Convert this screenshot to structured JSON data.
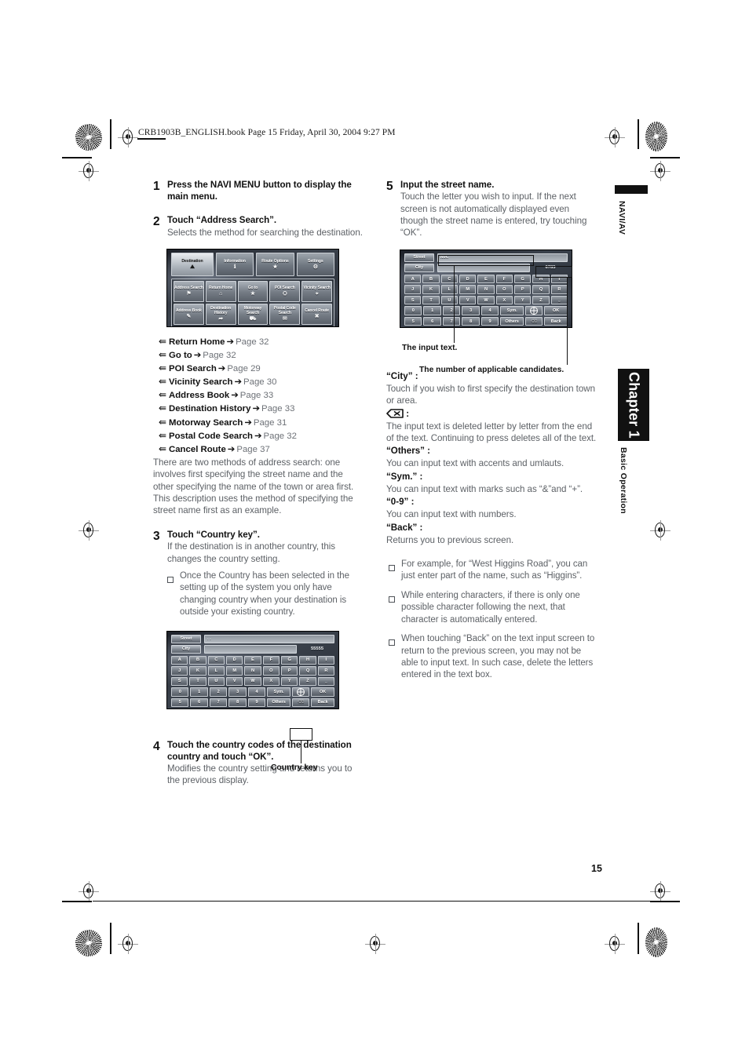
{
  "header": {
    "slug": "CRB1903B_ENGLISH.book  Page 15  Friday, April 30, 2004  9:27 PM"
  },
  "page_number": "15",
  "side_tabs": {
    "top_label": "NAVI/AV",
    "chapter_label": "Chapter 1",
    "section_label": "Basic Operation"
  },
  "left_column": {
    "steps": [
      {
        "num": "1",
        "title": "Press the NAVI MENU button to display the main menu.",
        "desc": ""
      },
      {
        "num": "2",
        "title": "Touch “Address Search”.",
        "desc": "Selects the method for searching the destination."
      },
      {
        "num": "3",
        "title": "Touch “Country key”.",
        "desc": "If the destination is in another country, this changes the country setting.",
        "note": "Once the Country has been selected in the setting up of the system you only have changing country when your destination is outside your existing country."
      },
      {
        "num": "4",
        "title": "Touch the country codes of the destination country and touch “OK”.",
        "desc": "Modifies the country setting and returns you to the previous display."
      }
    ],
    "arrow_list": [
      {
        "label": "Return Home",
        "ref": "Page 32"
      },
      {
        "label": "Go to",
        "ref": "Page 32"
      },
      {
        "label": "POI Search",
        "ref": "Page 29"
      },
      {
        "label": "Vicinity Search",
        "ref": "Page 30"
      },
      {
        "label": "Address Book",
        "ref": "Page 33"
      },
      {
        "label": "Destination History",
        "ref": "Page 33"
      },
      {
        "label": "Motorway Search",
        "ref": "Page 31"
      },
      {
        "label": "Postal Code Search",
        "ref": "Page 32"
      },
      {
        "label": "Cancel Route",
        "ref": "Page 37"
      }
    ],
    "paragraph": "There are two methods of address search: one involves first specifying the street name and the other specifying the name of the town or area first. This description uses the method of specifying the street name first as an example.",
    "country_key_caption": "Country key"
  },
  "right_column": {
    "step5": {
      "num": "5",
      "title": "Input the street name.",
      "desc": "Touch the letter you wish to input. If the next screen is not automatically displayed even though the street name is entered, try touching “OK”."
    },
    "captions": {
      "input_text": "The input text.",
      "candidates": "The number of applicable candidates."
    },
    "definitions": [
      {
        "term": "“City” :",
        "desc": "Touch if you wish to first specify the destination town or area."
      },
      {
        "term": "backspace-icon",
        "icon": true,
        "desc": "The input text is deleted letter by letter from the end of the text. Continuing to press deletes all of the text."
      },
      {
        "term": "“Others” :",
        "desc": "You can input text with accents and umlauts."
      },
      {
        "term": "“Sym.” :",
        "desc": "You can input text with marks such as “&”and “+”."
      },
      {
        "term": "“0-9” :",
        "desc": "You can input text with numbers."
      },
      {
        "term": "“Back” :",
        "desc": "Returns you to previous screen."
      }
    ],
    "notes": [
      "For example, for “West Higgins Road”, you can just enter part of the name, such as “Higgins”.",
      "While entering characters, if there is only one possible character following the next, that character is automatically entered.",
      "When touching “Back” on the text input screen to return to the previous screen, you may not be able to input text. In such case, delete the letters entered in the text box."
    ]
  },
  "nav_menu_screenshot": {
    "tabs": [
      {
        "label": "Destination",
        "icon": "⛰",
        "active": true
      },
      {
        "label": "Information",
        "icon": "ℹ",
        "active": false
      },
      {
        "label": "Route Options",
        "icon": "★",
        "active": false
      },
      {
        "label": "Settings",
        "icon": "⚙",
        "active": false
      }
    ],
    "row1": [
      {
        "label": "Address Search",
        "icon": "⚑"
      },
      {
        "label": "Return Home",
        "icon": "⌂"
      },
      {
        "label": "Go to",
        "icon": "★"
      },
      {
        "label": "POI Search",
        "icon": "⛭"
      },
      {
        "label": "Vicinity Search",
        "icon": "⌖"
      }
    ],
    "row2": [
      {
        "label": "Address Book",
        "icon": "✎"
      },
      {
        "label": "Destination History",
        "icon": "➦"
      },
      {
        "label": "Motorway Search",
        "icon": "⛟"
      },
      {
        "label": "Postal Code Search",
        "icon": "✉"
      },
      {
        "label": "Cancel Route",
        "icon": "✖"
      }
    ]
  },
  "keyboard_screenshot_country": {
    "street_label": "Street",
    "street_value": ". .",
    "city_label": "City",
    "count_value": "55555",
    "rows": [
      [
        "A",
        "B",
        "C",
        "D",
        "E",
        "F",
        "G",
        "H",
        "I"
      ],
      [
        "J",
        "K",
        "L",
        "M",
        "N",
        "O",
        "P",
        "Q",
        "R"
      ],
      [
        "S",
        "T",
        "U",
        "V",
        "W",
        "X",
        "Y",
        "Z",
        "⎵"
      ],
      [
        "0",
        "1",
        "2",
        "3",
        "4",
        "Sym.",
        "country-key",
        "OK"
      ],
      [
        "5",
        "6",
        "7",
        "8",
        "9",
        "Others",
        "⌫",
        "Back"
      ]
    ]
  },
  "keyboard_screenshot_street": {
    "street_label": "Street",
    "street_value": "MA.",
    "city_label": "City",
    "count_value": "6785",
    "rows": [
      [
        "A",
        "B",
        "C",
        "D",
        "E",
        "F",
        "G",
        "H",
        "I"
      ],
      [
        "J",
        "K",
        "L",
        "M",
        "N",
        "O",
        "P",
        "Q",
        "R"
      ],
      [
        "S",
        "T",
        "U",
        "V",
        "W",
        "X",
        "Y",
        "Z",
        "⎵"
      ],
      [
        "0",
        "1",
        "2",
        "3",
        "4",
        "Sym.",
        "country-key",
        "OK"
      ],
      [
        "5",
        "6",
        "7",
        "8",
        "9",
        "Others",
        "⌫",
        "Back"
      ]
    ]
  }
}
